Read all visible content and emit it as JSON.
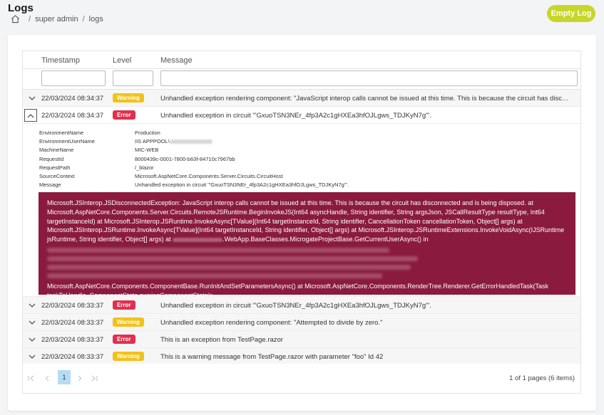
{
  "page": {
    "title": "Logs",
    "breadcrumb": [
      "super admin",
      "logs"
    ],
    "empty_button": "Empty Log"
  },
  "columns": [
    "Timestamp",
    "Level",
    "Message"
  ],
  "rows": [
    {
      "timestamp": "22/03/2024 08:34:37",
      "level": "Warning",
      "message": "Unhandled exception rendering component: \"JavaScript interop calls cannot be issued at this time. This is because the circuit has disconnected and i..."
    },
    {
      "timestamp": "22/03/2024 08:34:37",
      "level": "Error",
      "message": "Unhandled exception in circuit '\"GxuoTSN3NEr_4fp3A2c1gHXEa3hfOJLgws_TDJKyN7g\"'."
    },
    {
      "timestamp": "22/03/2024 08:33:37",
      "level": "Error",
      "message": "Unhandled exception in circuit '\"GxuoTSN3NEr_4fp3A2c1gHXEa3hfOJLgws_TDJKyN7g\"'."
    },
    {
      "timestamp": "22/03/2024 08:33:37",
      "level": "Warning",
      "message": "Unhandled exception rendering component: \"Attempted to divide by zero.\""
    },
    {
      "timestamp": "22/03/2024 08:33:37",
      "level": "Error",
      "message": "This is an exception from TestPage.razor"
    },
    {
      "timestamp": "22/03/2024 08:33:37",
      "level": "Warning",
      "message": "This is a warning message from TestPage.razor with parameter \"foo\" Id 42"
    }
  ],
  "detail": {
    "properties": [
      {
        "key": "EnvironmentName",
        "value": "Production"
      },
      {
        "key": "EnvironmentUserName",
        "value": "IIS APPPOOL\\"
      },
      {
        "key": "MachineName",
        "value": "MIC-WEB"
      },
      {
        "key": "RequestId",
        "value": "8000439c-0001-7800-b63f-84710c7967bb"
      },
      {
        "key": "RequestPath",
        "value": "/_blazor"
      },
      {
        "key": "SourceContext",
        "value": "Microsoft.AspNetCore.Components.Server.Circuits.CircuitHost"
      },
      {
        "key": "Message",
        "value": "Unhandled exception in circuit '\"GxuoTSN3NEr_4fp3A2c1gHXEa3hfOJLgws_TDJKyN7g\"'."
      }
    ],
    "exception_text": "Microsoft.JSInterop.JSDisconnectedException: JavaScript interop calls cannot be issued at this time. This is because the circuit has disconnected and is being disposed. at Microsoft.AspNetCore.Components.Server.Circuits.RemoteJSRuntime.BeginInvokeJS(Int64 asyncHandle, String identifier, String argsJson, JSCallResultType resultType, Int64 targetInstanceId) at Microsoft.JSInterop.JSRuntime.InvokeAsync[TValue](Int64 targetInstanceId, String identifier, CancellationToken cancellationToken, Object[] args) at Microsoft.JSInterop.JSRuntime.InvokeAsync[TValue](Int64 targetInstanceId, String identifier, Object[] args) at Microsoft.JSInterop.JSRuntimeExtensions.InvokeVoidAsync(IJSRuntime jsRuntime, String identifier, Object[] args) at",
    "exception_text_2": ".WebApp.BaseClasses.MicrogateProjectBase.GetCurrentUserAsync() in",
    "exception_tail": "Microsoft.AspNetCore.Components.ComponentBase.RunInitAndSetParametersAsync() at Microsoft.AspNetCore.Components.RenderTree.Renderer.GetErrorHandledTask(Task taskToHandle, ComponentState owningComponentState)>"
  },
  "pager": {
    "current_page": "1",
    "info": "1 of 1 pages (6 items)"
  },
  "colors": {
    "accent": "#c8d62a",
    "warning": "#f2c21b",
    "error": "#e0304e",
    "exception_bg": "#8a1b3e",
    "current_page": "#b6dcf5"
  }
}
